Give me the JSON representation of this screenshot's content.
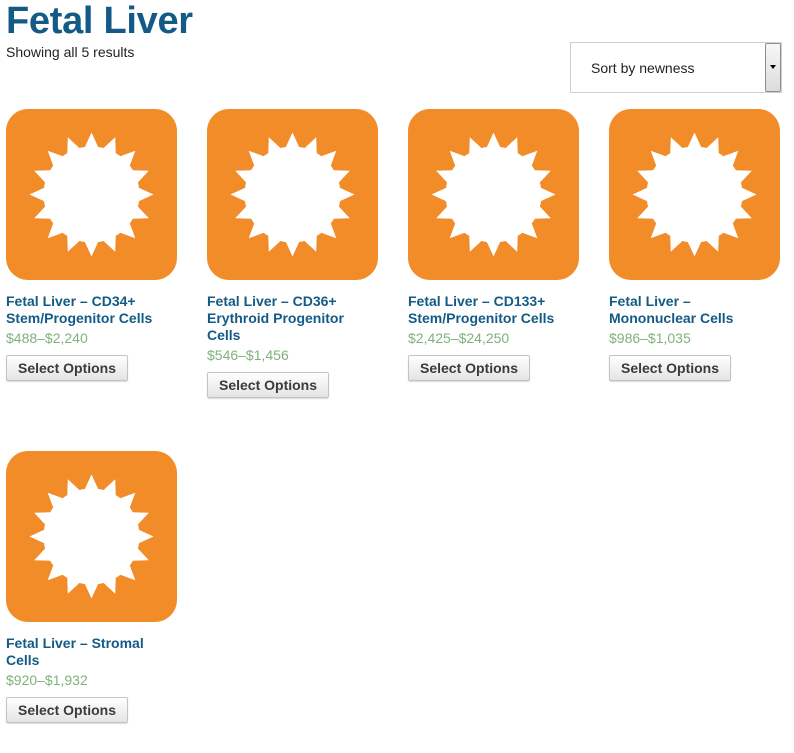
{
  "page": {
    "title": "Fetal Liver",
    "result_count": "Showing all 5 results"
  },
  "sort": {
    "selected": "Sort by newness"
  },
  "colors": {
    "title": "#135b86",
    "price": "#7fb27a",
    "image_bg": "#f28c28"
  },
  "products": [
    {
      "name": "Fetal Liver – CD34+ Stem/Progenitor Cells",
      "price": "$488–$2,240",
      "button": "Select Options",
      "image_icon": "sun-icon"
    },
    {
      "name": "Fetal Liver – CD36+ Erythroid Progenitor Cells",
      "price": "$546–$1,456",
      "button": "Select Options",
      "image_icon": "sun-icon"
    },
    {
      "name": "Fetal Liver – CD133+ Stem/Progenitor Cells",
      "price": "$2,425–$24,250",
      "button": "Select Options",
      "image_icon": "sun-icon"
    },
    {
      "name": "Fetal Liver – Mononuclear Cells",
      "price": "$986–$1,035",
      "button": "Select Options",
      "image_icon": "sun-icon"
    },
    {
      "name": "Fetal Liver – Stromal Cells",
      "price": "$920–$1,932",
      "button": "Select Options",
      "image_icon": "sun-icon"
    }
  ]
}
